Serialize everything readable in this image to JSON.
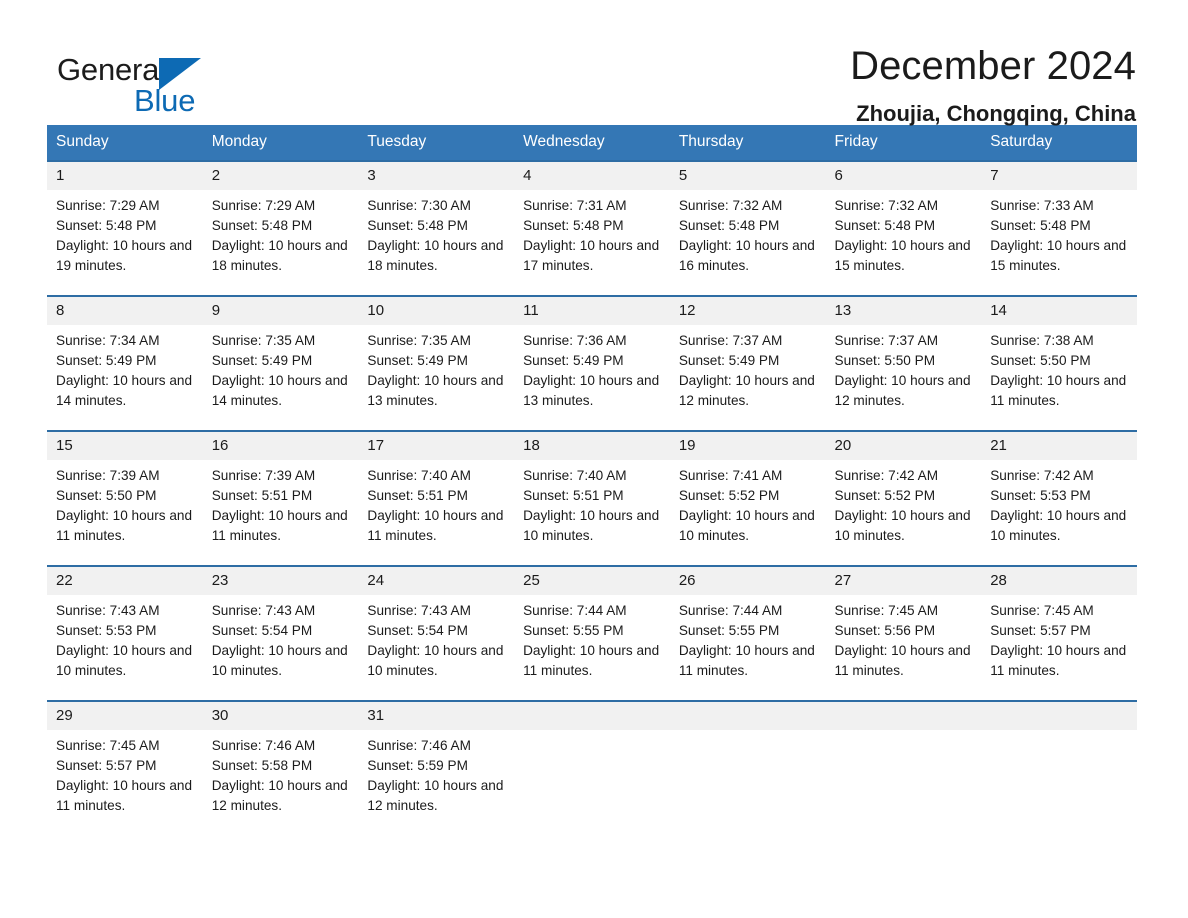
{
  "brand": {
    "name_part1": "General",
    "name_part2": "Blue",
    "triangle_color": "#0d6ab4"
  },
  "header": {
    "title": "December 2024",
    "location": "Zhoujia, Chongqing, China"
  },
  "theme": {
    "header_blue": "#3477b5",
    "row_border_blue": "#2e6da4",
    "date_band_gray": "#f1f1f1",
    "text_color": "#1b1b1b"
  },
  "calendar": {
    "weekday_headers": [
      "Sunday",
      "Monday",
      "Tuesday",
      "Wednesday",
      "Thursday",
      "Friday",
      "Saturday"
    ],
    "weeks": [
      [
        {
          "day": "1",
          "info": "Sunrise: 7:29 AM\nSunset: 5:48 PM\nDaylight: 10 hours and 19 minutes."
        },
        {
          "day": "2",
          "info": "Sunrise: 7:29 AM\nSunset: 5:48 PM\nDaylight: 10 hours and 18 minutes."
        },
        {
          "day": "3",
          "info": "Sunrise: 7:30 AM\nSunset: 5:48 PM\nDaylight: 10 hours and 18 minutes."
        },
        {
          "day": "4",
          "info": "Sunrise: 7:31 AM\nSunset: 5:48 PM\nDaylight: 10 hours and 17 minutes."
        },
        {
          "day": "5",
          "info": "Sunrise: 7:32 AM\nSunset: 5:48 PM\nDaylight: 10 hours and 16 minutes."
        },
        {
          "day": "6",
          "info": "Sunrise: 7:32 AM\nSunset: 5:48 PM\nDaylight: 10 hours and 15 minutes."
        },
        {
          "day": "7",
          "info": "Sunrise: 7:33 AM\nSunset: 5:48 PM\nDaylight: 10 hours and 15 minutes."
        }
      ],
      [
        {
          "day": "8",
          "info": "Sunrise: 7:34 AM\nSunset: 5:49 PM\nDaylight: 10 hours and 14 minutes."
        },
        {
          "day": "9",
          "info": "Sunrise: 7:35 AM\nSunset: 5:49 PM\nDaylight: 10 hours and 14 minutes."
        },
        {
          "day": "10",
          "info": "Sunrise: 7:35 AM\nSunset: 5:49 PM\nDaylight: 10 hours and 13 minutes."
        },
        {
          "day": "11",
          "info": "Sunrise: 7:36 AM\nSunset: 5:49 PM\nDaylight: 10 hours and 13 minutes."
        },
        {
          "day": "12",
          "info": "Sunrise: 7:37 AM\nSunset: 5:49 PM\nDaylight: 10 hours and 12 minutes."
        },
        {
          "day": "13",
          "info": "Sunrise: 7:37 AM\nSunset: 5:50 PM\nDaylight: 10 hours and 12 minutes."
        },
        {
          "day": "14",
          "info": "Sunrise: 7:38 AM\nSunset: 5:50 PM\nDaylight: 10 hours and 11 minutes."
        }
      ],
      [
        {
          "day": "15",
          "info": "Sunrise: 7:39 AM\nSunset: 5:50 PM\nDaylight: 10 hours and 11 minutes."
        },
        {
          "day": "16",
          "info": "Sunrise: 7:39 AM\nSunset: 5:51 PM\nDaylight: 10 hours and 11 minutes."
        },
        {
          "day": "17",
          "info": "Sunrise: 7:40 AM\nSunset: 5:51 PM\nDaylight: 10 hours and 11 minutes."
        },
        {
          "day": "18",
          "info": "Sunrise: 7:40 AM\nSunset: 5:51 PM\nDaylight: 10 hours and 10 minutes."
        },
        {
          "day": "19",
          "info": "Sunrise: 7:41 AM\nSunset: 5:52 PM\nDaylight: 10 hours and 10 minutes."
        },
        {
          "day": "20",
          "info": "Sunrise: 7:42 AM\nSunset: 5:52 PM\nDaylight: 10 hours and 10 minutes."
        },
        {
          "day": "21",
          "info": "Sunrise: 7:42 AM\nSunset: 5:53 PM\nDaylight: 10 hours and 10 minutes."
        }
      ],
      [
        {
          "day": "22",
          "info": "Sunrise: 7:43 AM\nSunset: 5:53 PM\nDaylight: 10 hours and 10 minutes."
        },
        {
          "day": "23",
          "info": "Sunrise: 7:43 AM\nSunset: 5:54 PM\nDaylight: 10 hours and 10 minutes."
        },
        {
          "day": "24",
          "info": "Sunrise: 7:43 AM\nSunset: 5:54 PM\nDaylight: 10 hours and 10 minutes."
        },
        {
          "day": "25",
          "info": "Sunrise: 7:44 AM\nSunset: 5:55 PM\nDaylight: 10 hours and 11 minutes."
        },
        {
          "day": "26",
          "info": "Sunrise: 7:44 AM\nSunset: 5:55 PM\nDaylight: 10 hours and 11 minutes."
        },
        {
          "day": "27",
          "info": "Sunrise: 7:45 AM\nSunset: 5:56 PM\nDaylight: 10 hours and 11 minutes."
        },
        {
          "day": "28",
          "info": "Sunrise: 7:45 AM\nSunset: 5:57 PM\nDaylight: 10 hours and 11 minutes."
        }
      ],
      [
        {
          "day": "29",
          "info": "Sunrise: 7:45 AM\nSunset: 5:57 PM\nDaylight: 10 hours and 11 minutes."
        },
        {
          "day": "30",
          "info": "Sunrise: 7:46 AM\nSunset: 5:58 PM\nDaylight: 10 hours and 12 minutes."
        },
        {
          "day": "31",
          "info": "Sunrise: 7:46 AM\nSunset: 5:59 PM\nDaylight: 10 hours and 12 minutes."
        },
        {
          "day": "",
          "info": ""
        },
        {
          "day": "",
          "info": ""
        },
        {
          "day": "",
          "info": ""
        },
        {
          "day": "",
          "info": ""
        }
      ]
    ]
  }
}
